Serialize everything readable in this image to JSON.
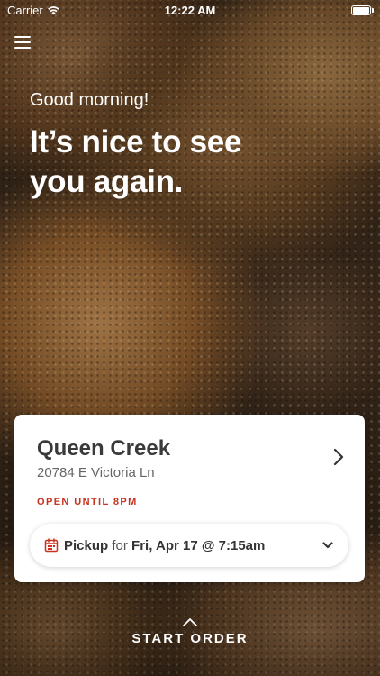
{
  "status_bar": {
    "carrier": "Carrier",
    "time": "12:22 AM",
    "icons": [
      "wifi-icon",
      "battery-icon"
    ]
  },
  "header": {
    "menu_icon": "hamburger-menu-icon"
  },
  "greeting": {
    "salutation": "Good morning!",
    "headline": "It’s nice to see you again."
  },
  "store_card": {
    "name": "Queen Creek",
    "address": "20784 E Victoria Ln",
    "open_status": "OPEN UNTIL 8PM",
    "chevron_icon": "chevron-right-icon",
    "pickup": {
      "icon": "calendar-icon",
      "mode": "Pickup",
      "for_text": "for",
      "time": "Fri, Apr 17 @ 7:15am",
      "dropdown_icon": "chevron-down-icon"
    }
  },
  "footer": {
    "up_icon": "chevron-up-icon",
    "start_order_label": "START ORDER"
  },
  "colors": {
    "accent_red": "#c8321e",
    "text_dark": "#3a3a3a",
    "text_muted": "#666666",
    "card_bg": "#ffffff"
  }
}
